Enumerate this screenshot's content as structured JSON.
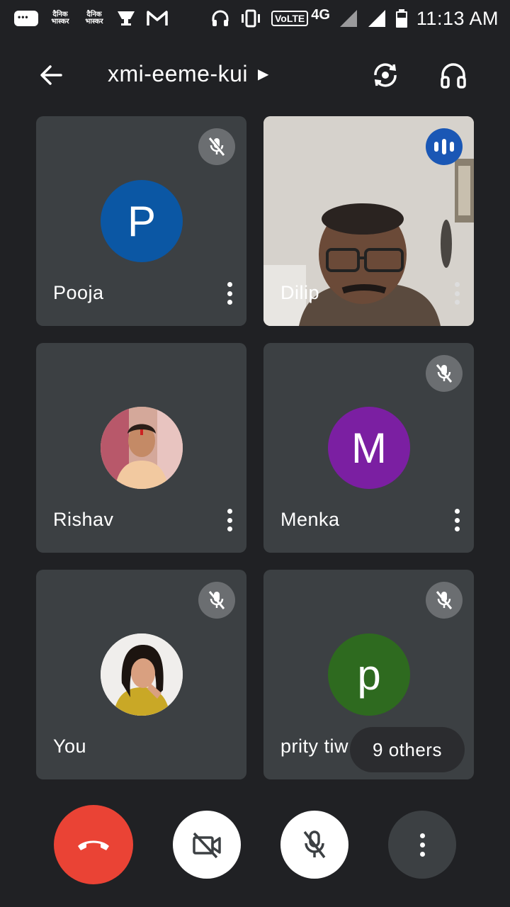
{
  "status_bar": {
    "logo_1": "दैनिक भास्कर",
    "logo_2": "दैनिक भास्कर",
    "volte": "VoLTE",
    "network": "4G",
    "time": "11:13 AM"
  },
  "header": {
    "meeting_code": "xmi-eeme-kui",
    "back_icon": "arrow-left-icon",
    "flip_camera_icon": "flip-camera-icon",
    "audio_icon": "headphones-icon"
  },
  "tiles": [
    {
      "name": "Pooja",
      "avatar_letter": "P",
      "avatar_color": "#0b57a4",
      "muted": true
    },
    {
      "name": "Dilip",
      "video": true,
      "speaking": true
    },
    {
      "name": "Rishav",
      "photo": true,
      "muted": false
    },
    {
      "name": "Menka",
      "avatar_letter": "M",
      "avatar_color": "#7b1fa2",
      "muted": true
    },
    {
      "name": "You",
      "photo": true,
      "muted": true
    },
    {
      "name": "prity tiw",
      "avatar_letter": "p",
      "avatar_color": "#2e6a1f",
      "muted": true
    }
  ],
  "others": {
    "label": "9 others"
  },
  "controls": {
    "hangup_color": "#ea4335",
    "camera_icon": "camera-off-icon",
    "mic_icon": "mic-off-icon",
    "more_icon": "more-vert-icon"
  }
}
